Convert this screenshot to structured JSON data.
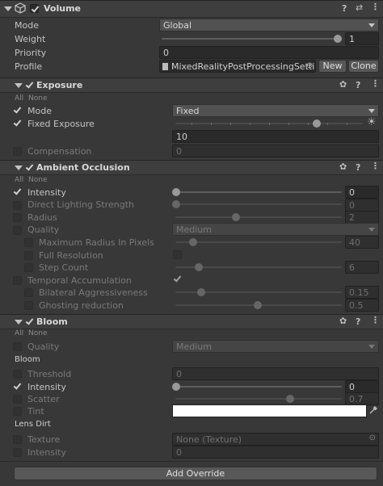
{
  "volume": {
    "title": "Volume",
    "mode_label": "Mode",
    "mode_value": "Global",
    "weight_label": "Weight",
    "weight_value": "1",
    "priority_label": "Priority",
    "priority_value": "0",
    "profile_label": "Profile",
    "profile_value": "MixedRealityPostProcessingSetti",
    "new_label": "New",
    "clone_label": "Clone"
  },
  "exposure": {
    "title": "Exposure",
    "all": "All",
    "none": "None",
    "mode_label": "Mode",
    "mode_value": "Fixed",
    "fixed_label": "Fixed Exposure",
    "fixed_value": "10",
    "comp_label": "Compensation",
    "comp_value": "0"
  },
  "ao": {
    "title": "Ambient Occlusion",
    "all": "All",
    "none": "None",
    "intensity_label": "Intensity",
    "intensity_value": "0",
    "direct_label": "Direct Lighting Strength",
    "direct_value": "0",
    "radius_label": "Radius",
    "radius_value": "2",
    "quality_label": "Quality",
    "quality_value": "Medium",
    "maxrad_label": "Maximum Radius In Pixels",
    "maxrad_value": "40",
    "fullres_label": "Full Resolution",
    "step_label": "Step Count",
    "step_value": "6",
    "temporal_label": "Temporal Accumulation",
    "bilat_label": "Bilateral Aggressiveness",
    "bilat_value": "0.15",
    "ghost_label": "Ghosting reduction",
    "ghost_value": "0.5"
  },
  "bloom": {
    "title": "Bloom",
    "all": "All",
    "none": "None",
    "quality_label": "Quality",
    "quality_value": "Medium",
    "section_bloom": "Bloom",
    "threshold_label": "Threshold",
    "threshold_value": "0",
    "intensity_label": "Intensity",
    "intensity_value": "0",
    "scatter_label": "Scatter",
    "scatter_value": "0.7",
    "tint_label": "Tint",
    "section_lens": "Lens Dirt",
    "texture_label": "Texture",
    "texture_value": "None (Texture)",
    "lens_int_label": "Intensity",
    "lens_int_value": "0"
  },
  "add_override": "Add Override",
  "icons": [
    "cube-icon",
    "help-icon",
    "preset-icon",
    "more-icon",
    "settings-icon",
    "eyedropper-icon",
    "object-picker-icon",
    "sun-icon"
  ]
}
